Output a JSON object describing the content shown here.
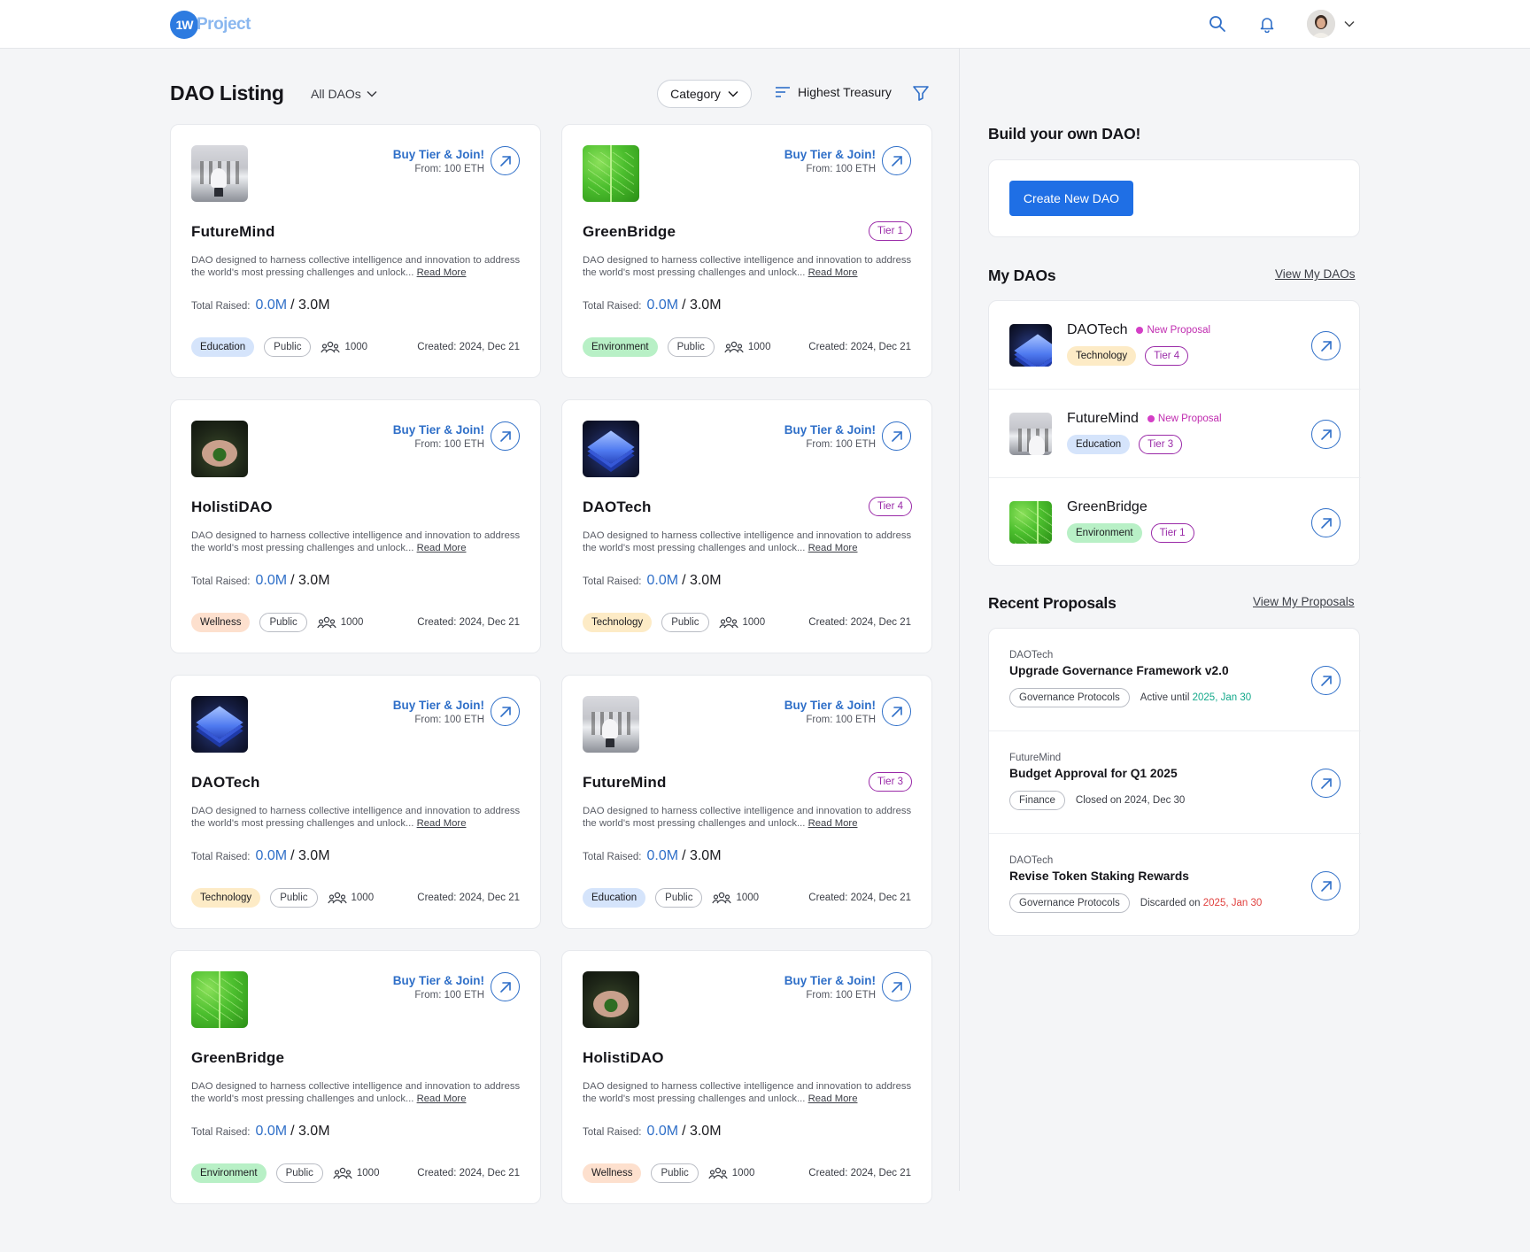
{
  "header": {
    "logo_mark": "1W",
    "logo_text": "Project"
  },
  "listing": {
    "title": "DAO Listing",
    "view_filter": "All DAOs",
    "category_label": "Category",
    "sort_label": "Highest Treasury"
  },
  "cards": [
    {
      "name": "FutureMind",
      "image": "futuremind",
      "buy": "Buy Tier & Join!",
      "from": "From: 100 ETH",
      "tier": "",
      "desc": "DAO designed to harness collective intelligence and innovation to address the world's most pressing challenges and unlock...",
      "read_more": "Read More",
      "raised_label": "Total Raised:",
      "raised": "0.0M",
      "total": "/ 3.0M",
      "category": "Education",
      "category_key": "education",
      "visibility": "Public",
      "members": "1000",
      "created": "Created: 2024, Dec 21"
    },
    {
      "name": "GreenBridge",
      "image": "greenbridge",
      "buy": "Buy Tier & Join!",
      "from": "From: 100 ETH",
      "tier": "Tier 1",
      "desc": "DAO designed to harness collective intelligence and innovation to address the world's most pressing challenges and unlock...",
      "read_more": "Read More",
      "raised_label": "Total Raised:",
      "raised": "0.0M",
      "total": "/ 3.0M",
      "category": "Environment",
      "category_key": "environment",
      "visibility": "Public",
      "members": "1000",
      "created": "Created: 2024, Dec 21"
    },
    {
      "name": "HolistiDAO",
      "image": "holistidao",
      "buy": "Buy Tier & Join!",
      "from": "From: 100 ETH",
      "tier": "",
      "desc": "DAO designed to harness collective intelligence and innovation to address the world's most pressing challenges and unlock...",
      "read_more": "Read More",
      "raised_label": "Total Raised:",
      "raised": "0.0M",
      "total": "/ 3.0M",
      "category": "Wellness",
      "category_key": "wellness",
      "visibility": "Public",
      "members": "1000",
      "created": "Created: 2024, Dec 21"
    },
    {
      "name": "DAOTech",
      "image": "daotech",
      "buy": "Buy Tier & Join!",
      "from": "From: 100 ETH",
      "tier": "Tier 4",
      "desc": "DAO designed to harness collective intelligence and innovation to address the world's most pressing challenges and unlock...",
      "read_more": "Read More",
      "raised_label": "Total Raised:",
      "raised": "0.0M",
      "total": "/ 3.0M",
      "category": "Technology",
      "category_key": "technology",
      "visibility": "Public",
      "members": "1000",
      "created": "Created: 2024, Dec 21"
    },
    {
      "name": "DAOTech",
      "image": "daotech",
      "buy": "Buy Tier & Join!",
      "from": "From: 100 ETH",
      "tier": "",
      "desc": "DAO designed to harness collective intelligence and innovation to address the world's most pressing challenges and unlock...",
      "read_more": "Read More",
      "raised_label": "Total Raised:",
      "raised": "0.0M",
      "total": "/ 3.0M",
      "category": "Technology",
      "category_key": "technology",
      "visibility": "Public",
      "members": "1000",
      "created": "Created: 2024, Dec 21"
    },
    {
      "name": "FutureMind",
      "image": "futuremind",
      "buy": "Buy Tier & Join!",
      "from": "From: 100 ETH",
      "tier": "Tier 3",
      "desc": "DAO designed to harness collective intelligence and innovation to address the world's most pressing challenges and unlock...",
      "read_more": "Read More",
      "raised_label": "Total Raised:",
      "raised": "0.0M",
      "total": "/ 3.0M",
      "category": "Education",
      "category_key": "education",
      "visibility": "Public",
      "members": "1000",
      "created": "Created: 2024, Dec 21"
    },
    {
      "name": "GreenBridge",
      "image": "greenbridge",
      "buy": "Buy Tier & Join!",
      "from": "From: 100 ETH",
      "tier": "",
      "desc": "DAO designed to harness collective intelligence and innovation to address the world's most pressing challenges and unlock...",
      "read_more": "Read More",
      "raised_label": "Total Raised:",
      "raised": "0.0M",
      "total": "/ 3.0M",
      "category": "Environment",
      "category_key": "environment",
      "visibility": "Public",
      "members": "1000",
      "created": "Created: 2024, Dec 21"
    },
    {
      "name": "HolistiDAO",
      "image": "holistidao",
      "buy": "Buy Tier & Join!",
      "from": "From: 100 ETH",
      "tier": "",
      "desc": "DAO designed to harness collective intelligence and innovation to address the world's most pressing challenges and unlock...",
      "read_more": "Read More",
      "raised_label": "Total Raised:",
      "raised": "0.0M",
      "total": "/ 3.0M",
      "category": "Wellness",
      "category_key": "wellness",
      "visibility": "Public",
      "members": "1000",
      "created": "Created: 2024, Dec 21"
    }
  ],
  "sidebar": {
    "build_title": "Build your own DAO!",
    "create_label": "Create New DAO",
    "my_daos_title": "My DAOs",
    "view_my_daos": "View My DAOs",
    "my_daos": [
      {
        "name": "DAOTech",
        "image": "daotech",
        "new_proposal": "New Proposal",
        "category": "Technology",
        "category_key": "technology",
        "tier": "Tier 4"
      },
      {
        "name": "FutureMind",
        "image": "futuremind",
        "new_proposal": "New Proposal",
        "category": "Education",
        "category_key": "education",
        "tier": "Tier 3"
      },
      {
        "name": "GreenBridge",
        "image": "greenbridge",
        "new_proposal": "",
        "category": "Environment",
        "category_key": "environment",
        "tier": "Tier 1"
      }
    ],
    "recent_title": "Recent Proposals",
    "view_my_proposals": "View My Proposals",
    "proposals": [
      {
        "dao": "DAOTech",
        "title": "Upgrade Governance Framework v2.0",
        "tag": "Governance Protocols",
        "status": "Active until",
        "date": "2025, Jan 30",
        "date_style": "green"
      },
      {
        "dao": "FutureMind",
        "title": "Budget Approval for Q1 2025",
        "tag": "Finance",
        "status": "Closed on",
        "date": "2024, Dec 30",
        "date_style": "plain"
      },
      {
        "dao": "DAOTech",
        "title": "Revise Token Staking Rewards",
        "tag": "Governance Protocols",
        "status": "Discarded on",
        "date": "2025, Jan 30",
        "date_style": "red"
      }
    ]
  },
  "colors": {
    "accent": "#2f6fc8",
    "primary_button": "#1f6fe5",
    "tier": "#9a2aa8",
    "new_proposal": "#c02cb0",
    "active_date": "#13a88a",
    "discarded_date": "#e0413f"
  }
}
